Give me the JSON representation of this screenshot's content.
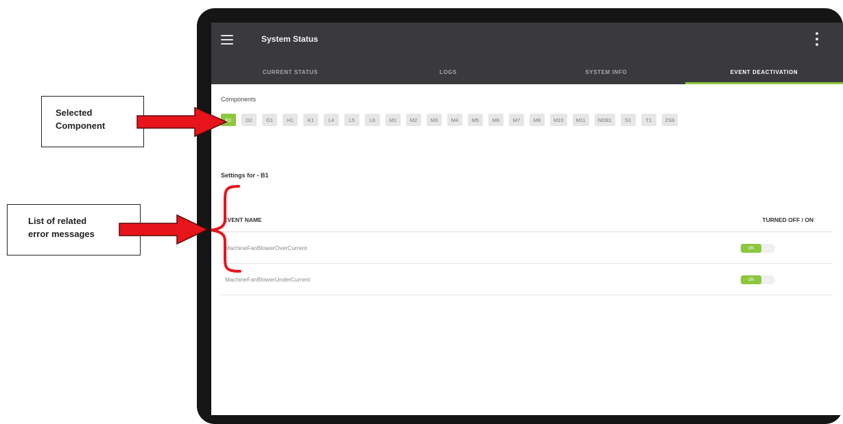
{
  "app": {
    "title": "System Status"
  },
  "tabs": [
    {
      "label": "CURRENT STATUS",
      "active": false
    },
    {
      "label": "LOGS",
      "active": false
    },
    {
      "label": "SYSTEM INFO",
      "active": false
    },
    {
      "label": "EVENT DEACTIVATION",
      "active": true
    }
  ],
  "components": {
    "label": "Components",
    "selected": "B1",
    "items": [
      "B1",
      "D2",
      "G1",
      "H1",
      "K1",
      "L4",
      "L5",
      "L6",
      "M1",
      "M2",
      "M3",
      "M4",
      "M5",
      "M6",
      "M7",
      "M8",
      "M10",
      "M11",
      "NDB1",
      "S1",
      "T1",
      "ZS9"
    ]
  },
  "settings": {
    "label": "Settings for - B1"
  },
  "table": {
    "col_name": "EVENT NAME",
    "col_toggle": "TURNED OFF / ON",
    "rows": [
      {
        "name": "MachineFanBlowerOverCurrent",
        "toggle_label": "ON",
        "on": true
      },
      {
        "name": "MachineFanBlowerUnderCurrent",
        "toggle_label": "ON",
        "on": true
      }
    ]
  },
  "annotations": {
    "selected_component": {
      "line1": "Selected",
      "line2": "Component"
    },
    "related_errors": {
      "line1": "List of related",
      "line2": "error messages"
    }
  },
  "colors": {
    "accent": "#8dc63f",
    "appbar": "#3a3a3d",
    "arrow": "#e8141b"
  }
}
